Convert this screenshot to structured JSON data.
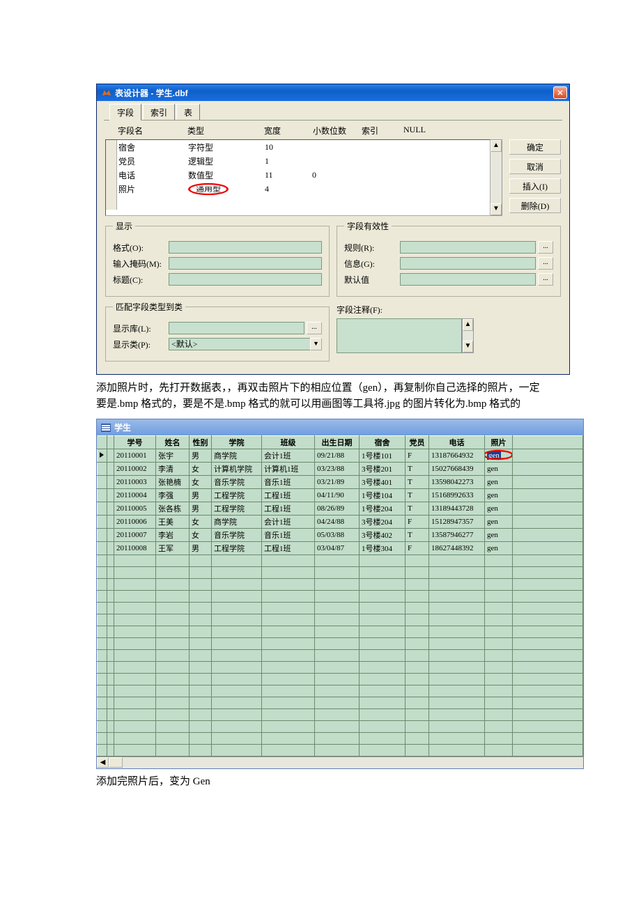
{
  "designer": {
    "title": "表设计器 - 学生.dbf",
    "close": "✕",
    "tabs": [
      "字段",
      "索引",
      "表"
    ],
    "headers": {
      "name": "字段名",
      "type": "类型",
      "width": "宽度",
      "dec": "小数位数",
      "index": "索引",
      "null": "NULL"
    },
    "rows": [
      {
        "name": "宿舍",
        "type": "字符型",
        "width": "10",
        "dec": ""
      },
      {
        "name": "党员",
        "type": "逻辑型",
        "width": "1",
        "dec": ""
      },
      {
        "name": "电话",
        "type": "数值型",
        "width": "11",
        "dec": "0"
      },
      {
        "name": "照片",
        "type": "通用型",
        "width": "4",
        "dec": ""
      }
    ],
    "buttons": {
      "ok": "确定",
      "cancel": "取消",
      "insert": "插入(I)",
      "delete": "删除(D)"
    },
    "scroll": {
      "up": "▲",
      "down": "▼"
    },
    "display": {
      "legend": "显示",
      "format": "格式(O):",
      "mask": "输入掩码(M):",
      "caption": "标题(C):"
    },
    "validity": {
      "legend": "字段有效性",
      "rule": "规则(R):",
      "info": "信息(G):",
      "default": "默认值"
    },
    "mapping": {
      "legend": "匹配字段类型到类",
      "lib": "显示库(L):",
      "cls": "显示类(P):",
      "default_cls": "<默认>",
      "dots": "..."
    },
    "comment": {
      "label": "字段注释(F):"
    }
  },
  "paragraph1": "添加照片时，先打开数据表，，再双击照片下的相应位置（gen），再复制你自己选择的照片，一定要是.bmp 格式的，要是不是.bmp 格式的就可以用画图等工具将.jpg 的图片转化为.bmp 格式的",
  "browse": {
    "title": "学生",
    "headers": {
      "id": "学号",
      "name": "姓名",
      "sex": "性别",
      "college": "学院",
      "class": "班级",
      "birth": "出生日期",
      "dorm": "宿舍",
      "party": "党员",
      "phone": "电话",
      "photo": "照片"
    },
    "rows": [
      {
        "id": "20110001",
        "name": "张宇",
        "sex": "男",
        "college": "商学院",
        "class": "会计1班",
        "birth": "09/21/88",
        "dorm": "1号楼101",
        "party": "F",
        "phone": "13187664932",
        "photo": "gen",
        "sel": true
      },
      {
        "id": "20110002",
        "name": "李清",
        "sex": "女",
        "college": "计算机学院",
        "class": "计算机1班",
        "birth": "03/23/88",
        "dorm": "3号楼201",
        "party": "T",
        "phone": "15027668439",
        "photo": "gen"
      },
      {
        "id": "20110003",
        "name": "张艳楠",
        "sex": "女",
        "college": "音乐学院",
        "class": "音乐1班",
        "birth": "03/21/89",
        "dorm": "3号楼401",
        "party": "T",
        "phone": "13598042273",
        "photo": "gen"
      },
      {
        "id": "20110004",
        "name": "李强",
        "sex": "男",
        "college": "工程学院",
        "class": "工程1班",
        "birth": "04/11/90",
        "dorm": "1号楼104",
        "party": "T",
        "phone": "15168992633",
        "photo": "gen"
      },
      {
        "id": "20110005",
        "name": "张各栋",
        "sex": "男",
        "college": "工程学院",
        "class": "工程1班",
        "birth": "08/26/89",
        "dorm": "1号楼204",
        "party": "T",
        "phone": "13189443728",
        "photo": "gen"
      },
      {
        "id": "20110006",
        "name": "王美",
        "sex": "女",
        "college": "商学院",
        "class": "会计1班",
        "birth": "04/24/88",
        "dorm": "3号楼204",
        "party": "F",
        "phone": "15128947357",
        "photo": "gen"
      },
      {
        "id": "20110007",
        "name": "李岩",
        "sex": "女",
        "college": "音乐学院",
        "class": "音乐1班",
        "birth": "05/03/88",
        "dorm": "3号楼402",
        "party": "T",
        "phone": "13587946277",
        "photo": "gen"
      },
      {
        "id": "20110008",
        "name": "王军",
        "sex": "男",
        "college": "工程学院",
        "class": "工程1班",
        "birth": "03/04/87",
        "dorm": "1号楼304",
        "party": "F",
        "phone": "18627448392",
        "photo": "gen"
      }
    ],
    "empty_rows": 17
  },
  "paragraph2": "添加完照片后，变为 Gen"
}
